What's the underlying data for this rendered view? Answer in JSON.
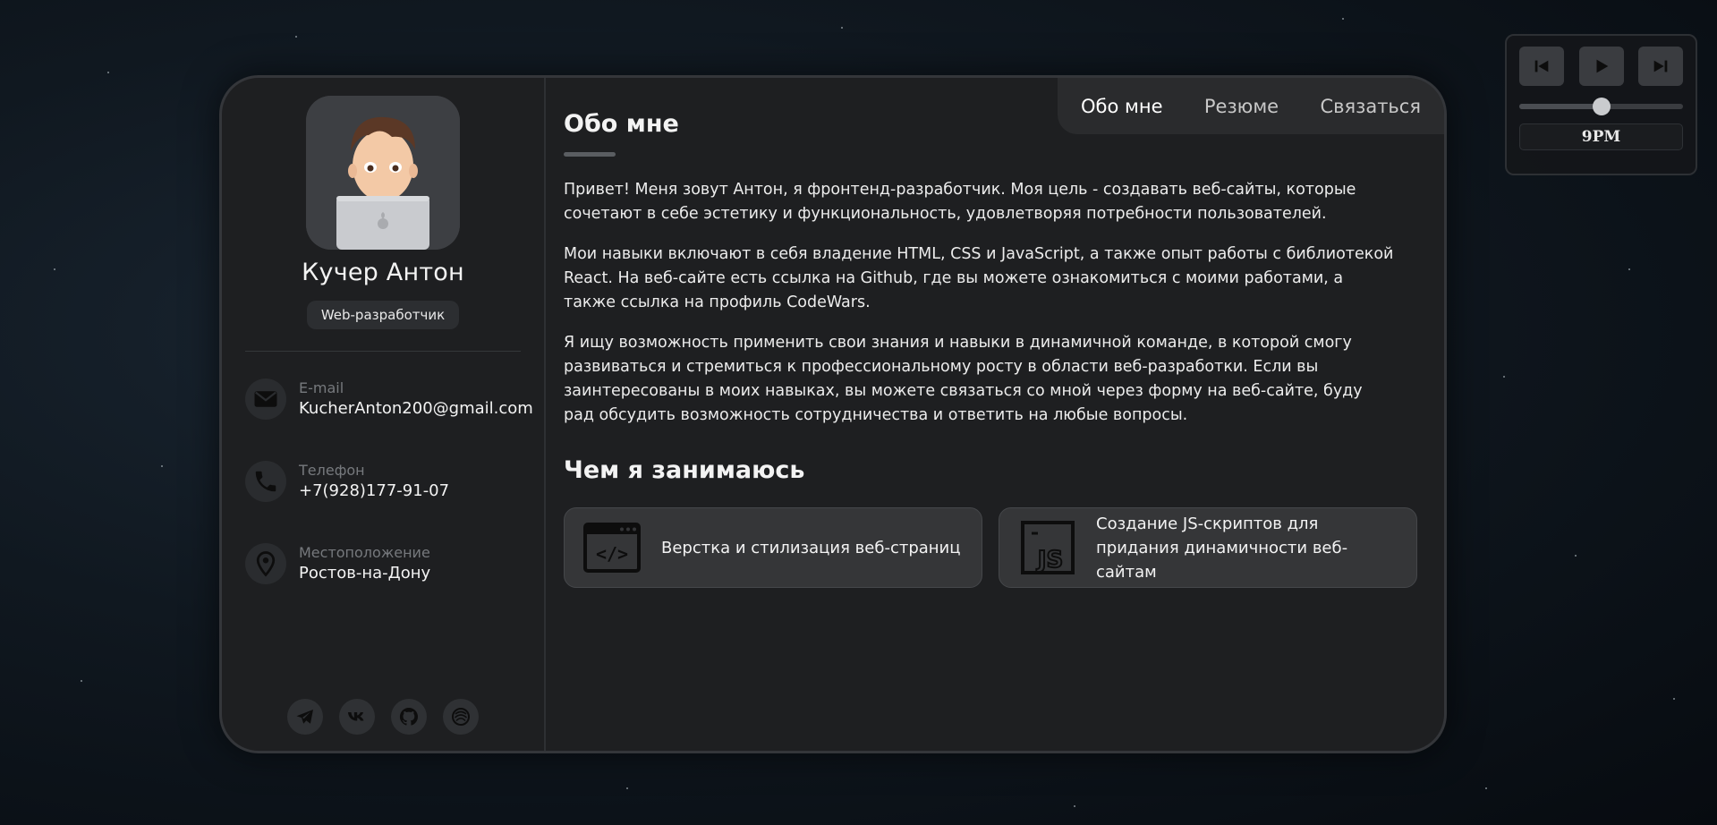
{
  "profile": {
    "name": "Кучер Антон",
    "role": "Web-разработчик",
    "avatar_icon": "memoji-laptop-avatar"
  },
  "contacts": [
    {
      "icon": "mail-icon",
      "label": "E-mail",
      "value": "KucherAnton200@gmail.com"
    },
    {
      "icon": "phone-icon",
      "label": "Телефон",
      "value": "+7(928)177-91-07"
    },
    {
      "icon": "location-pin-icon",
      "label": "Местоположение",
      "value": "Ростов-на-Дону"
    }
  ],
  "socials": [
    "telegram-icon",
    "vk-icon",
    "github-icon",
    "codewars-icon"
  ],
  "nav": {
    "items": [
      "Обо мне",
      "Резюме",
      "Связаться"
    ],
    "active": "Обо мне"
  },
  "about": {
    "title": "Обо мне",
    "paragraphs": [
      "Привет! Меня зовут Антон, я фронтенд-разработчик. Моя цель - создавать веб-сайты, которые сочетают в себе эстетику и функциональность, удовлетворяя потребности пользователей.",
      "Мои навыки включают в себя владение HTML, CSS и JavaScript, а также опыт работы с библиотекой React. На веб-сайте есть ссылка на Github, где вы можете ознакомиться с моими работами, а также ссылка на профиль CodeWars.",
      "Я ищу возможность применить свои знания и навыки в динамичной команде, в которой смогу развиваться и стремиться к профессиональному росту в области веб-разработки. Если вы заинтересованы в моих навыках, вы можете связаться со мной через форму на веб-сайте, буду рад обсудить возможность сотрудничества и ответить на любые вопросы."
    ],
    "services_title": "Чем я занимаюсь",
    "services": [
      {
        "icon": "code-window-icon",
        "text": "Верстка и стилизация веб-страниц"
      },
      {
        "icon": "js-icon",
        "text": "Создание JS-скриптов для придания динамичности веб-сайтам"
      }
    ]
  },
  "player": {
    "buttons": [
      "skip-back-icon",
      "play-icon",
      "skip-forward-icon"
    ],
    "volume": 0.5,
    "time_label": "9PM"
  },
  "colors": {
    "background": "#0b1118",
    "card": "#1e1f21",
    "card_border": "#34363a",
    "accent_muted": "#5a5d61",
    "text": "#f3f3f3",
    "label": "#76797d"
  }
}
